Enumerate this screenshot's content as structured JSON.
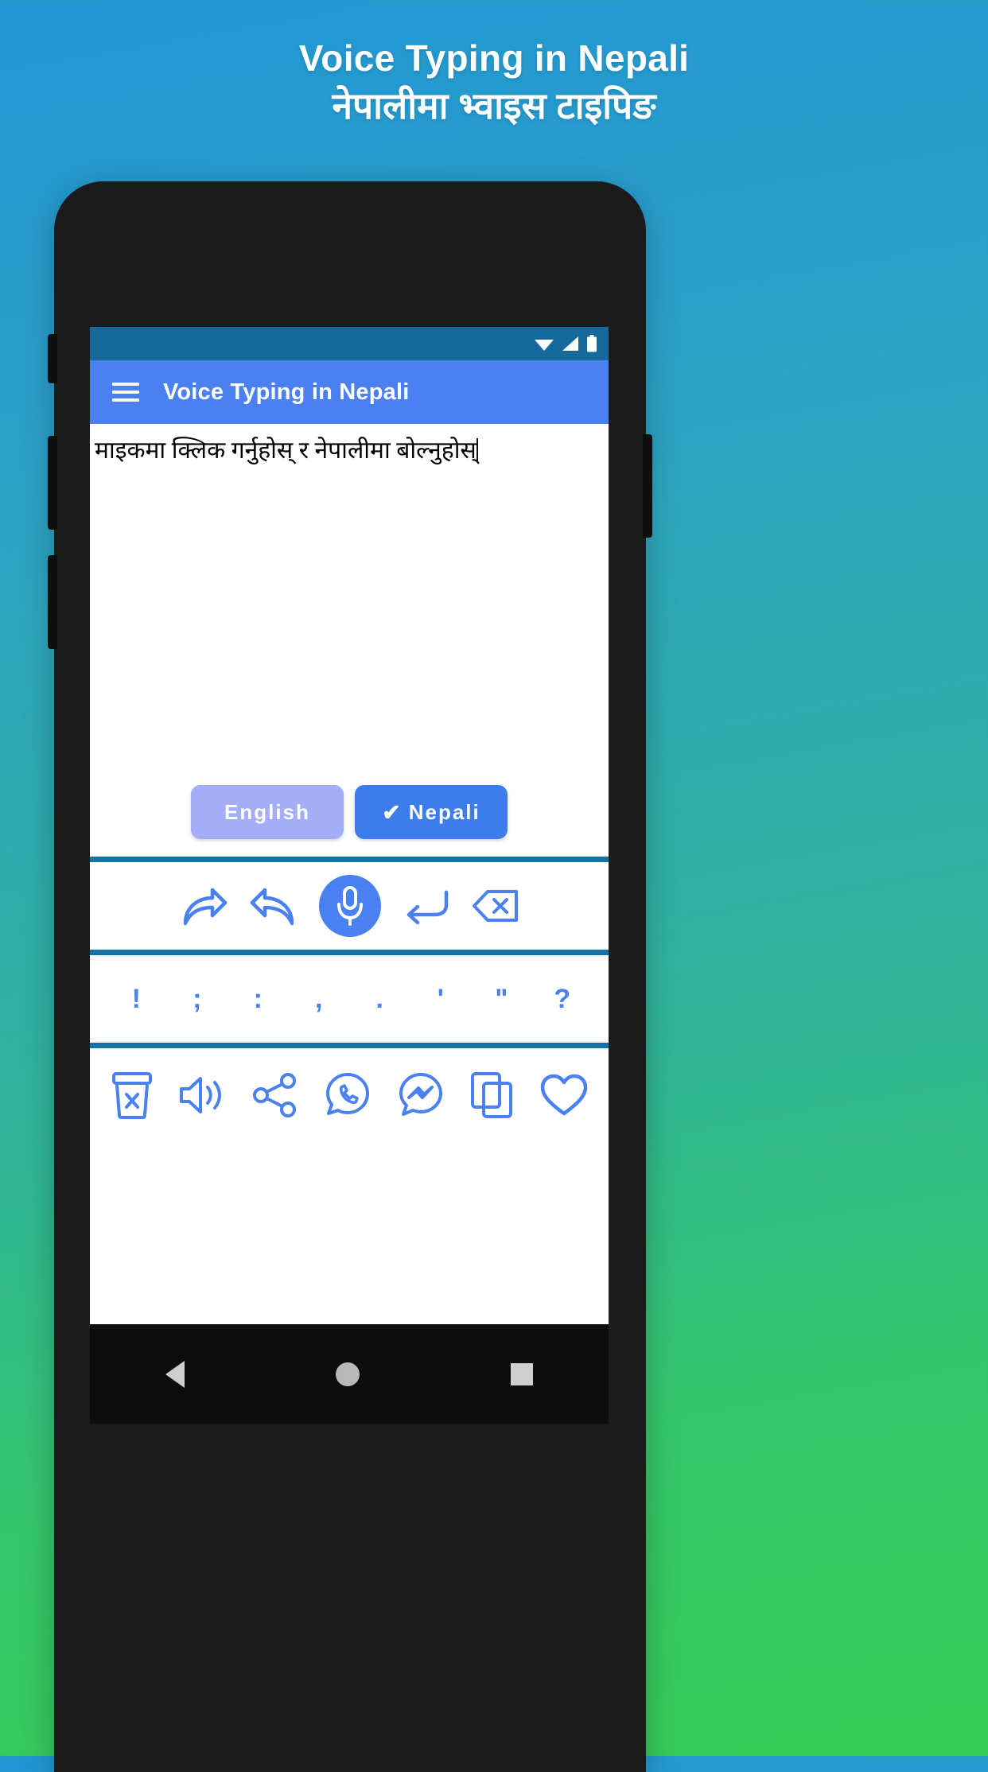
{
  "promo": {
    "title": "Voice Typing in Nepali",
    "subtitle": "नेपालीमा भ्वाइस टाइपिङ"
  },
  "colors": {
    "bg_top": "#2196d3",
    "bg_bottom": "#37cc55",
    "appbar": "#4a80ef",
    "statusbar": "#15699c",
    "accent": "#4a80ef",
    "rule": "#1572a6",
    "inactive_button": "#a3aef7",
    "active_button": "#3d7ceb"
  },
  "statusbar": {
    "icons": [
      "wifi-icon",
      "signal-icon",
      "battery-icon"
    ]
  },
  "appbar": {
    "menu_icon": "hamburger-menu-icon",
    "title": "Voice Typing in Nepali"
  },
  "editor": {
    "text": "माइकमा क्लिक गर्नुहोस् र नेपालीमा बोल्नुहोस्",
    "placeholder": "माइकमा क्लिक गर्नुहोस् र नेपालीमा बोल्नुहोस्"
  },
  "languages": [
    {
      "label": "English",
      "selected": false,
      "check": ""
    },
    {
      "label": "Nepali",
      "selected": true,
      "check": "✔"
    }
  ],
  "toolbar": {
    "items": [
      {
        "name": "redo-icon",
        "label": "Redo"
      },
      {
        "name": "undo-icon",
        "label": "Undo"
      },
      {
        "name": "microphone-icon",
        "label": "Microphone"
      },
      {
        "name": "newline-icon",
        "label": "New line"
      },
      {
        "name": "backspace-icon",
        "label": "Backspace"
      }
    ]
  },
  "punctuation": {
    "keys": [
      "!",
      ";",
      ":",
      ",",
      ".",
      "'",
      "\"",
      "?"
    ]
  },
  "actions": {
    "items": [
      {
        "name": "delete-icon",
        "label": "Delete"
      },
      {
        "name": "speaker-icon",
        "label": "Speak"
      },
      {
        "name": "share-icon",
        "label": "Share"
      },
      {
        "name": "whatsapp-icon",
        "label": "WhatsApp"
      },
      {
        "name": "messenger-icon",
        "label": "Messenger"
      },
      {
        "name": "copy-icon",
        "label": "Copy"
      },
      {
        "name": "heart-icon",
        "label": "Favourite"
      }
    ]
  },
  "navbar": {
    "buttons": [
      "back-button",
      "home-button",
      "recents-button"
    ]
  }
}
